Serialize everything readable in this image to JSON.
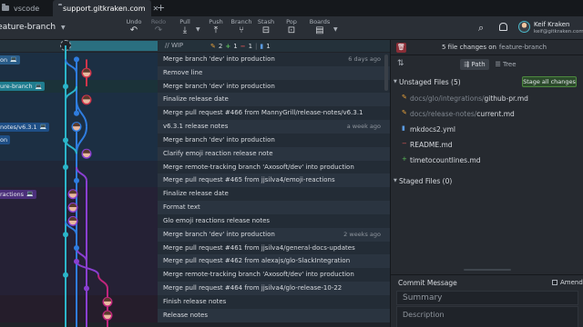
{
  "tabs": [
    {
      "label": "vscode",
      "active": false
    },
    {
      "label": "support.gitkraken.com",
      "active": true
    }
  ],
  "toolbar": {
    "branch": "feature-branch",
    "buttons": [
      {
        "label": "Undo",
        "icon": "undo-icon",
        "glyph": "↶",
        "enabled": true
      },
      {
        "label": "Redo",
        "icon": "redo-icon",
        "glyph": "↷",
        "enabled": false
      },
      {
        "label": "Pull",
        "icon": "pull-icon",
        "glyph": "⤓",
        "enabled": true
      },
      {
        "label": "Push",
        "icon": "push-icon",
        "glyph": "⤒",
        "enabled": true
      },
      {
        "label": "Branch",
        "icon": "branch-icon",
        "glyph": "⑂",
        "enabled": true
      },
      {
        "label": "Stash",
        "icon": "stash-icon",
        "glyph": "⊟",
        "enabled": true
      },
      {
        "label": "Pop",
        "icon": "pop-icon",
        "glyph": "⊡",
        "enabled": true
      },
      {
        "label": "Boards",
        "icon": "boards-icon",
        "glyph": "▤",
        "enabled": true
      }
    ],
    "user_name": "Keif Kraken",
    "user_email": "keif@gitkraken.com"
  },
  "wip": {
    "label": "// WIP",
    "modified": "2",
    "added": "1",
    "removed": "1",
    "files": "1"
  },
  "refs": [
    {
      "label": "on",
      "row": 0,
      "color": "#2a5d8a",
      "icon": "💻"
    },
    {
      "label": "ure-branch",
      "row": 2,
      "color": "#1f7d8f",
      "icon": "💻"
    },
    {
      "label": "notes/v6.3.1",
      "row": 5,
      "color": "#1f4f86",
      "icon": "💻"
    },
    {
      "label": "on",
      "row": 6,
      "color": "#1f4f86",
      "icon": ""
    },
    {
      "label": "ractions",
      "row": 10,
      "color": "#4b2f7a",
      "icon": "💻"
    }
  ],
  "commits": [
    {
      "message": "Merge branch 'dev' into production",
      "time": "6 days ago"
    },
    {
      "message": "Remove line",
      "time": ""
    },
    {
      "message": "Merge branch 'dev' into production",
      "time": ""
    },
    {
      "message": "Finalize release date",
      "time": ""
    },
    {
      "message": "Merge pull request #466 from MannyGrill/release-notes/v6.3.1",
      "time": ""
    },
    {
      "message": "v6.3.1 release notes",
      "time": "a week ago"
    },
    {
      "message": "Merge branch 'dev' into production",
      "time": ""
    },
    {
      "message": "Clarify emoji reaction release note",
      "time": ""
    },
    {
      "message": "Merge remote-tracking branch 'Axosoft/dev' into production",
      "time": ""
    },
    {
      "message": "Merge pull request #465 from jjsilva4/emoji-reactions",
      "time": ""
    },
    {
      "message": "Finalize release date",
      "time": ""
    },
    {
      "message": "Format text",
      "time": ""
    },
    {
      "message": "Glo emoji reactions release notes",
      "time": ""
    },
    {
      "message": "Merge branch 'dev' into production",
      "time": "2 weeks ago"
    },
    {
      "message": "Merge pull request #461 from jjsilva4/general-docs-updates",
      "time": ""
    },
    {
      "message": "Merge pull request #462 from alexajs/glo-SlackIntegration",
      "time": ""
    },
    {
      "message": "Merge remote-tracking branch 'Axosoft/dev' into production",
      "time": ""
    },
    {
      "message": "Merge pull request #464 from jjsilva4/glo-release-10-22",
      "time": ""
    },
    {
      "message": "Finish release notes",
      "time": ""
    },
    {
      "message": "Release notes",
      "time": ""
    }
  ],
  "panel": {
    "file_count_text": "5 file changes on",
    "branch": "feature-branch",
    "view_path": "Path",
    "view_tree": "Tree",
    "unstaged_label": "Unstaged Files (5)",
    "stage_all": "Stage all changes",
    "unstaged_files": [
      {
        "dir": "docs/glo/integrations/",
        "name": "github-pr.md",
        "status": "modified"
      },
      {
        "dir": "docs/release-notes/",
        "name": "current.md",
        "status": "modified"
      },
      {
        "dir": "",
        "name": "mkdocs2.yml",
        "status": "file"
      },
      {
        "dir": "",
        "name": "README.md",
        "status": "removed"
      },
      {
        "dir": "",
        "name": "timetocountlines.md",
        "status": "added"
      }
    ],
    "staged_label": "Staged Files (0)",
    "commit_title": "Commit Message",
    "amend": "Amend",
    "summary_placeholder": "Summary",
    "description_placeholder": "Description"
  },
  "colors": {
    "accent": "#2a6f80",
    "lane_cyan": "#2bb5c9",
    "lane_blue": "#2f7de0",
    "lane_purple": "#8a3fd1",
    "lane_magenta": "#c0257d",
    "lane_red": "#d1354b"
  }
}
